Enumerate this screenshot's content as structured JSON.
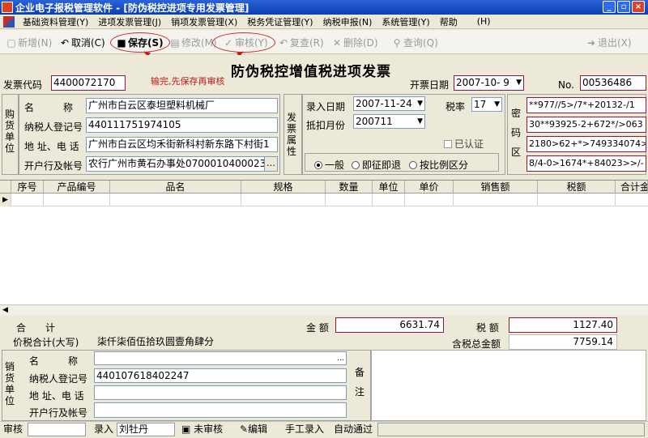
{
  "window": {
    "title": "企业电子报税管理软件 - [防伪税控进项专用发票管理]",
    "minimize": "_",
    "restore": "▫",
    "close": "×"
  },
  "menu": [
    "基础资料管理(Y)",
    "进项发票管理(J)",
    "销项发票管理(X)",
    "税务凭证管理(Y)",
    "纳税申报(N)",
    "系统管理(Y)",
    "帮助",
    "(H)"
  ],
  "toolbar": {
    "new": "新增(N)",
    "cancel": "取消(C)",
    "save": "保存(S)",
    "modify": "修改(M)",
    "audit": "审核(Y)",
    "reaudit": "复查(R)",
    "delete": "删除(D)",
    "query": "查询(Q)",
    "exit": "退出(X)"
  },
  "annotation": "输完,先保存再审核",
  "invoice": {
    "title": "防伪税控增值税进项发票",
    "code_label": "发票代码",
    "code": "4400072170",
    "date_label": "开票日期",
    "date": "2007-10- 9",
    "no_label": "No.",
    "no": "00536486",
    "buyer_side": "购货单位",
    "buyer": {
      "name_label": "名　　　称",
      "name": "广州市白云区泰坦塑料机械厂",
      "tax_label": "纳税人登记号",
      "tax": "440111751974105",
      "addr_label": "地 址、电 话",
      "addr": "广州市白云区均禾街新科村新东路下村街1",
      "bank_label": "开户行及帐号",
      "bank": "农行广州市黄石办事处07000104000231"
    },
    "attr_side": "发票属性",
    "entry_date_label": "录入日期",
    "entry_date": "2007-11-24",
    "tax_rate_label": "税率",
    "tax_rate": "17",
    "deduct_label": "抵扣月份",
    "deduct": "200711",
    "certified_label": "已认证",
    "radios": [
      "一般",
      "即征即退",
      "按比例区分"
    ],
    "cipher_side": "密码区",
    "cipher": [
      "**977//5>/7*+20132-/1",
      "30**93925-2+672*/>063",
      "2180>62+*>749334074>9",
      "8/4-0>1674*+84023>>/-"
    ]
  },
  "grid": {
    "columns": [
      "序号",
      "产品编号",
      "品名",
      "规格",
      "数量",
      "单位",
      "单价",
      "销售额",
      "税额",
      "合计金"
    ]
  },
  "footer": {
    "total_label": "合　　计",
    "amount_label": "金 额",
    "amount": "6631.74",
    "tax_label": "税 额",
    "tax": "1127.40",
    "big_label": "价税合计(大写)",
    "big": "柒仟柒佰伍拾玖圆壹角肆分",
    "gross_label": "含税总金额",
    "gross": "7759.14",
    "seller_side": "销货单位",
    "seller": {
      "name_label": "名　　　称",
      "name": "",
      "tax_label": "纳税人登记号",
      "tax": "440107618402247",
      "addr_label": "地 址、电 话",
      "addr": "",
      "bank_label": "开户行及帐号",
      "bank": ""
    },
    "remark_label": "备注"
  },
  "status": {
    "auditor_label": "审核",
    "auditor": "",
    "entry_label": "录入",
    "entry": "刘牡丹",
    "unaudited": "未审核",
    "edit": "编辑",
    "manual": "手工录入",
    "auto": "自动通过"
  }
}
